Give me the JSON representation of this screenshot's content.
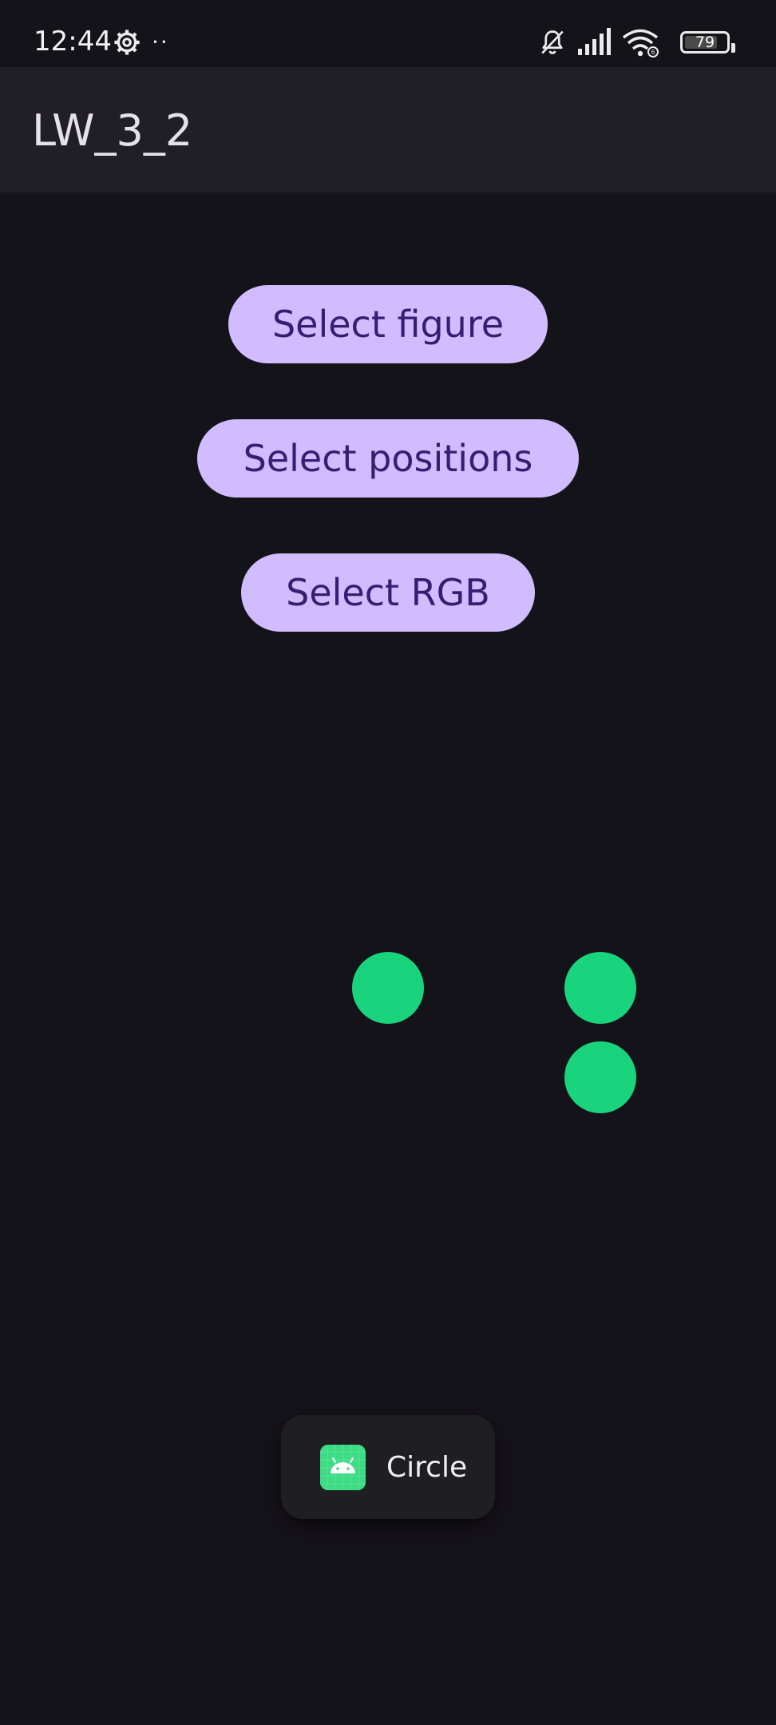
{
  "status_bar": {
    "time": "12:44",
    "overflow_dots": "··",
    "battery_level": "79",
    "battery_fraction": 0.79
  },
  "app_bar": {
    "title": "LW_3_2"
  },
  "buttons": {
    "select_figure": "Select figure",
    "select_positions": "Select positions",
    "select_rgb": "Select RGB"
  },
  "figures": {
    "shape": "circle",
    "count": 3,
    "color": "#19d47c"
  },
  "toast": {
    "message": "Circle",
    "icon": "android-app-icon"
  },
  "colors": {
    "background": "#15131a",
    "app_bar": "#211f26",
    "button_fill": "#d0bcff",
    "button_text": "#381e72",
    "toast_bg": "#1f1f21",
    "android_green": "#3ddc84"
  }
}
